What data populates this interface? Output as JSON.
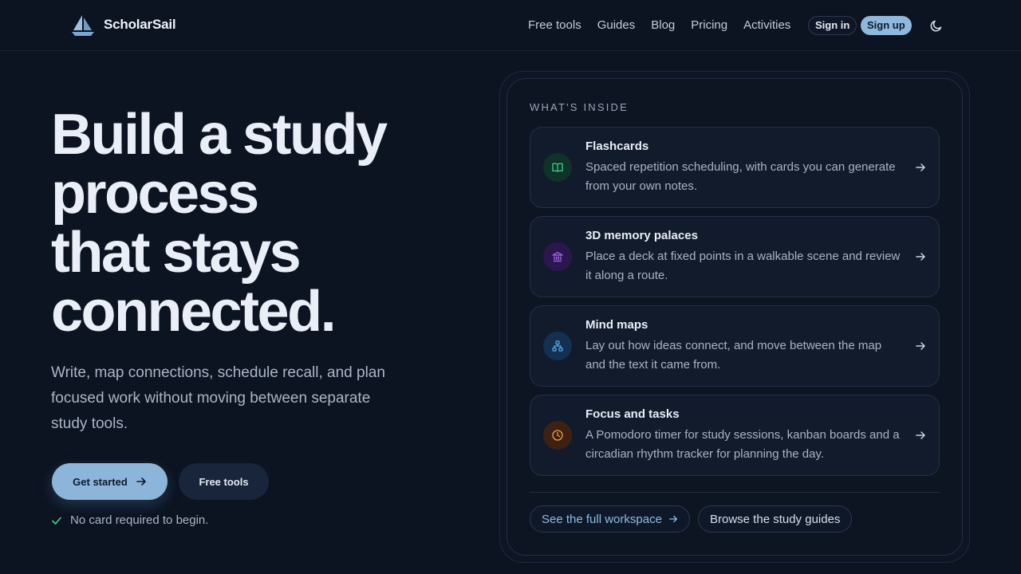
{
  "brand": {
    "name": "ScholarSail"
  },
  "nav": {
    "links": [
      "Free tools",
      "Guides",
      "Blog",
      "Pricing",
      "Activities"
    ],
    "sign_in": "Sign in",
    "sign_up": "Sign up"
  },
  "hero": {
    "title_lines": [
      "Build a study",
      "process",
      "that stays",
      "connected."
    ],
    "subtitle": "Write, map connections, schedule recall, and plan focused work without moving between separate study tools.",
    "primary_cta": "Get started",
    "secondary_cta": "Free tools",
    "note": "No card required to begin."
  },
  "panel": {
    "label": "WHAT'S INSIDE",
    "cards": [
      {
        "title": "Flashcards",
        "desc": "Spaced repetition scheduling, with cards you can generate from your own notes.",
        "icon": "book-icon",
        "color": "#3fcf8e"
      },
      {
        "title": "3D memory palaces",
        "desc": "Place a deck at fixed points in a walkable scene and review it along a route.",
        "icon": "building-icon",
        "color": "#a96cf0"
      },
      {
        "title": "Mind maps",
        "desc": "Lay out how ideas connect, and move between the map and the text it came from.",
        "icon": "network-icon",
        "color": "#5aaee8"
      },
      {
        "title": "Focus and tasks",
        "desc": "A Pomodoro timer for study sessions, kanban boards and a circadian rhythm tracker for planning the day.",
        "icon": "clock-icon",
        "color": "#f0a040"
      }
    ],
    "link_workspace": "See the full workspace",
    "link_guides": "Browse the study guides"
  }
}
